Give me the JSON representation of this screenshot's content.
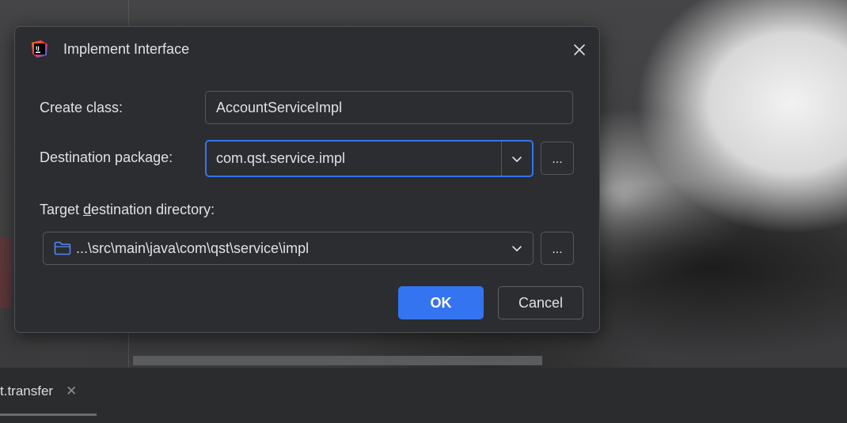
{
  "dialog": {
    "title": "Implement Interface",
    "app_icon": "intellij-idea-icon",
    "close_icon": "close-icon",
    "create_class_label": "Create class:",
    "create_class_value": "AccountServiceImpl",
    "dest_package_label": "Destination package:",
    "dest_package_value": "com.qst.service.impl",
    "target_dir_label_prefix": "Target ",
    "target_dir_label_mnemonic": "d",
    "target_dir_label_suffix": "estination directory:",
    "target_dir_value": "...\\src\\main\\java\\com\\qst\\service\\impl",
    "browse_label": "...",
    "ok_label": "OK",
    "cancel_label": "Cancel"
  },
  "editor_tab": {
    "label": "t.transfer",
    "close_glyph": "✕"
  },
  "colors": {
    "dialog_bg": "#2b2d30",
    "accent": "#3574f0",
    "text": "#dfe1e5",
    "border": "#55585d"
  }
}
